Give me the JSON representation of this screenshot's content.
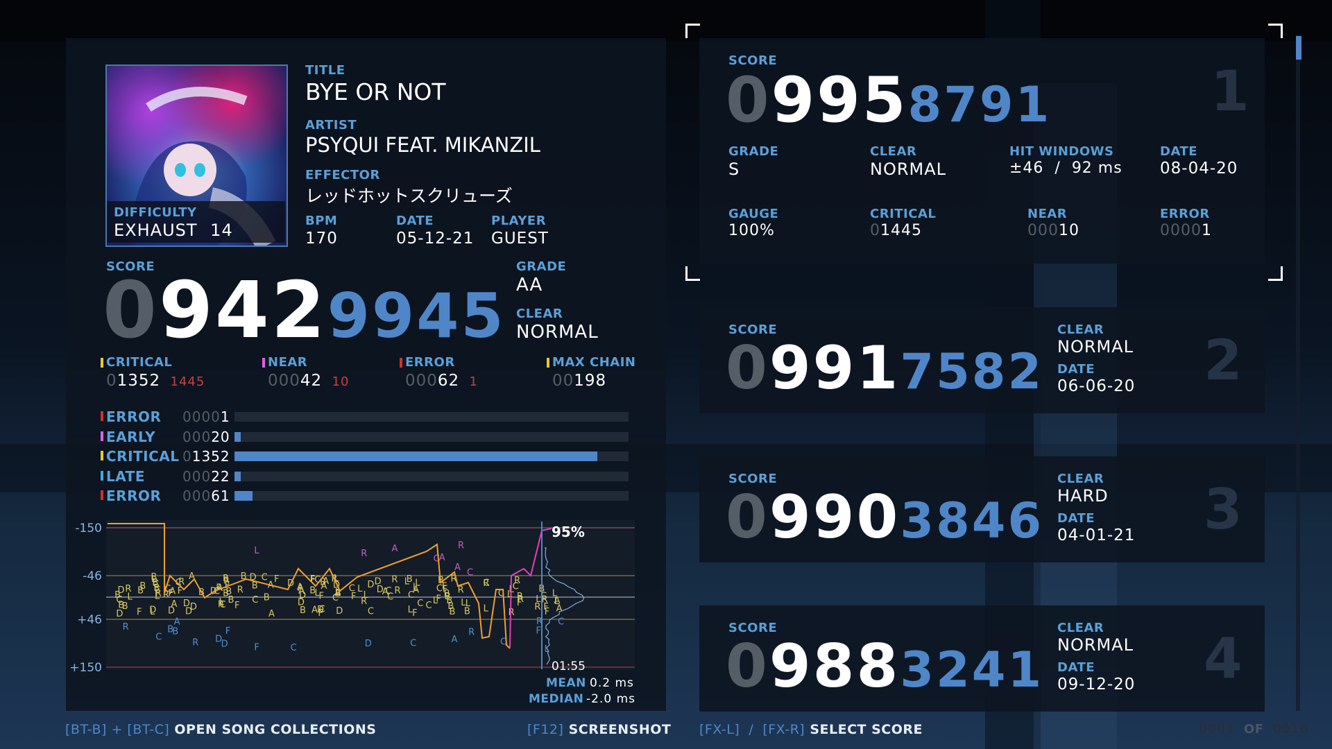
{
  "song": {
    "title_label": "TITLE",
    "title": "BYE OR NOT",
    "artist_label": "ARTIST",
    "artist": "PSYQUI FEAT. MIKANZIL",
    "effector_label": "EFFECTOR",
    "effector": "レッドホットスクリューズ",
    "difficulty_label": "DIFFICULTY",
    "difficulty": "EXHAUST",
    "level": "14",
    "bpm_label": "BPM",
    "bpm": "170",
    "date_label": "DATE",
    "date": "05-12-21",
    "player_label": "PLAYER",
    "player": "GUEST"
  },
  "current": {
    "score_label": "SCORE",
    "score_dim": "0",
    "score_main": "942",
    "score_sub": "9945",
    "grade_label": "GRADE",
    "grade": "AA",
    "clear_label": "CLEAR",
    "clear": "NORMAL",
    "stats": [
      {
        "label": "CRITICAL",
        "dim": "0",
        "value": "1352",
        "diff": "1445",
        "color": "#e8c930"
      },
      {
        "label": "NEAR",
        "dim": "000",
        "value": "42",
        "diff": "10",
        "color": "#e060e0"
      },
      {
        "label": "ERROR",
        "dim": "000",
        "value": "62",
        "diff": "1",
        "color": "#d03030"
      },
      {
        "label": "MAX CHAIN",
        "dim": "00",
        "value": "198",
        "diff": "",
        "color": "#e8c930"
      }
    ],
    "breakdown": [
      {
        "label": "ERROR",
        "dim": "0000",
        "value": "1",
        "fraction": 0.0,
        "color": "#d03030"
      },
      {
        "label": "EARLY",
        "dim": "000",
        "value": "20",
        "fraction": 0.015,
        "color": "#e060e0"
      },
      {
        "label": "CRITICAL",
        "dim": "0",
        "value": "1352",
        "fraction": 0.92,
        "color": "#e8c930"
      },
      {
        "label": "LATE",
        "dim": "000",
        "value": "22",
        "fraction": 0.016,
        "color": "#40a8e0"
      },
      {
        "label": "ERROR",
        "dim": "000",
        "value": "61",
        "fraction": 0.045,
        "color": "#d03030"
      }
    ]
  },
  "graph": {
    "y_ticks": [
      "-150",
      "-46",
      "+46",
      "+150"
    ],
    "gauge_end": "95%",
    "duration": "01:55",
    "mean_label": "MEAN",
    "mean": "0.2 ms",
    "median_label": "MEDIAN",
    "median": "-2.0 ms"
  },
  "best": {
    "score_label": "SCORE",
    "score_dim": "0",
    "score_main": "995",
    "score_sub": "8791",
    "rank": "1",
    "grade_label": "GRADE",
    "grade": "S",
    "clear_label": "CLEAR",
    "clear": "NORMAL",
    "hit_label": "HIT WINDOWS",
    "hit": "±46  /  92 ms",
    "date_label": "DATE",
    "date": "08-04-20",
    "gauge_label": "GAUGE",
    "gauge": "100%",
    "critical_label": "CRITICAL",
    "critical_dim": "0",
    "critical": "1445",
    "near_label": "NEAR",
    "near_dim": "000",
    "near": "10",
    "error_label": "ERROR",
    "error_dim": "0000",
    "error": "1"
  },
  "others": [
    {
      "score_label": "SCORE",
      "dim": "0",
      "main": "991",
      "sub": "7582",
      "clear_label": "CLEAR",
      "clear": "NORMAL",
      "date_label": "DATE",
      "date": "06-06-20",
      "rank": "2"
    },
    {
      "score_label": "SCORE",
      "dim": "0",
      "main": "990",
      "sub": "3846",
      "clear_label": "CLEAR",
      "clear": "HARD",
      "date_label": "DATE",
      "date": "04-01-21",
      "rank": "3"
    },
    {
      "score_label": "SCORE",
      "dim": "0",
      "main": "988",
      "sub": "3241",
      "clear_label": "CLEAR",
      "clear": "NORMAL",
      "date_label": "DATE",
      "date": "09-12-20",
      "rank": "4"
    }
  ],
  "footer": {
    "collections_keys": "[BT-B] + [BT-C]",
    "collections": "OPEN SONG COLLECTIONS",
    "screenshot_key": "[F12]",
    "screenshot": "SCREENSHOT",
    "select_keys": "[FX-L]  /  [FX-R]",
    "select": "SELECT SCORE",
    "page_dim": "000",
    "page_current": "1",
    "page_of": "OF",
    "page_dim2": "00",
    "page_total": "10"
  },
  "colors": {
    "accent": "#4f86c8",
    "critical": "#e8c930",
    "near": "#e060e0",
    "error": "#d03030",
    "late": "#40a8e0",
    "gauge": "#f0a030"
  }
}
